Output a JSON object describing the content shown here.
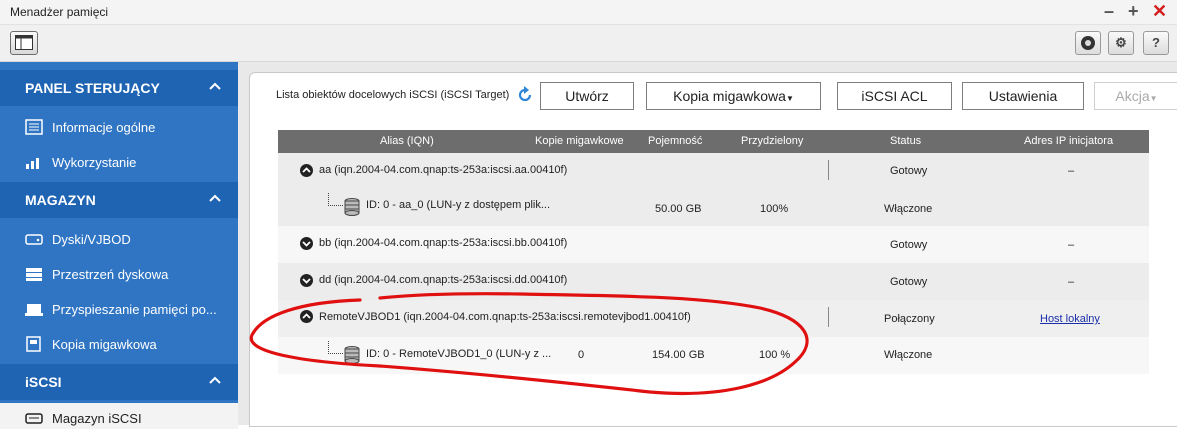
{
  "window": {
    "title": "Menadżer pamięci"
  },
  "sidebar": {
    "sections": [
      {
        "label": "PANEL STERUJĄCY",
        "items": [
          {
            "label": "Informacje ogólne"
          },
          {
            "label": "Wykorzystanie"
          }
        ]
      },
      {
        "label": "MAGAZYN",
        "items": [
          {
            "label": "Dyski/VJBOD"
          },
          {
            "label": "Przestrzeń dyskowa"
          },
          {
            "label": "Przyspieszanie pamięci po..."
          },
          {
            "label": "Kopia migawkowa"
          }
        ]
      },
      {
        "label": "iSCSI",
        "items": [
          {
            "label": "Magazyn iSCSI"
          }
        ]
      }
    ]
  },
  "toolbar": {
    "list_label": "Lista obiektów docelowych iSCSI (iSCSI Target)",
    "create_label": "Utwórz",
    "snapshot_label": "Kopia migawkowa",
    "acl_label": "iSCSI ACL",
    "settings_label": "Ustawienia",
    "action_label": "Akcja"
  },
  "table": {
    "columns": [
      "Alias (IQN)",
      "Kopie migawkowe",
      "Pojemność",
      "Przydzielony",
      "Status",
      "Adres IP inicjatora"
    ],
    "rows": [
      {
        "alias": "aa (iqn.2004-04.com.qnap:ts-253a:iscsi.aa.00410f)",
        "status": "Gotowy",
        "ip": "–"
      },
      {
        "alias": "ID: 0 - aa_0 (LUN-y z dostępem plik...",
        "snapshots": "",
        "capacity": "50.00 GB",
        "allocated": "100%",
        "status": "Włączone"
      },
      {
        "alias": "bb (iqn.2004-04.com.qnap:ts-253a:iscsi.bb.00410f)",
        "status": "Gotowy",
        "ip": "–"
      },
      {
        "alias": "dd (iqn.2004-04.com.qnap:ts-253a:iscsi.dd.00410f)",
        "status": "Gotowy",
        "ip": "–"
      },
      {
        "alias": "RemoteVJBOD1 (iqn.2004-04.com.qnap:ts-253a:iscsi.remotevjbod1.00410f)",
        "status": "Połączony",
        "ip": "Host lokalny"
      },
      {
        "alias": "ID: 0 - RemoteVJBOD1_0 (LUN-y z ...",
        "snapshots": "0",
        "capacity": "154.00 GB",
        "allocated": "100 %",
        "status": "Włączone"
      }
    ]
  },
  "colors": {
    "sidebar": "#2f75c3",
    "sidebar_header": "#1f64b3",
    "table_header": "#6d6d6d",
    "annotation": "#e01010",
    "close": "#d31c1c"
  }
}
